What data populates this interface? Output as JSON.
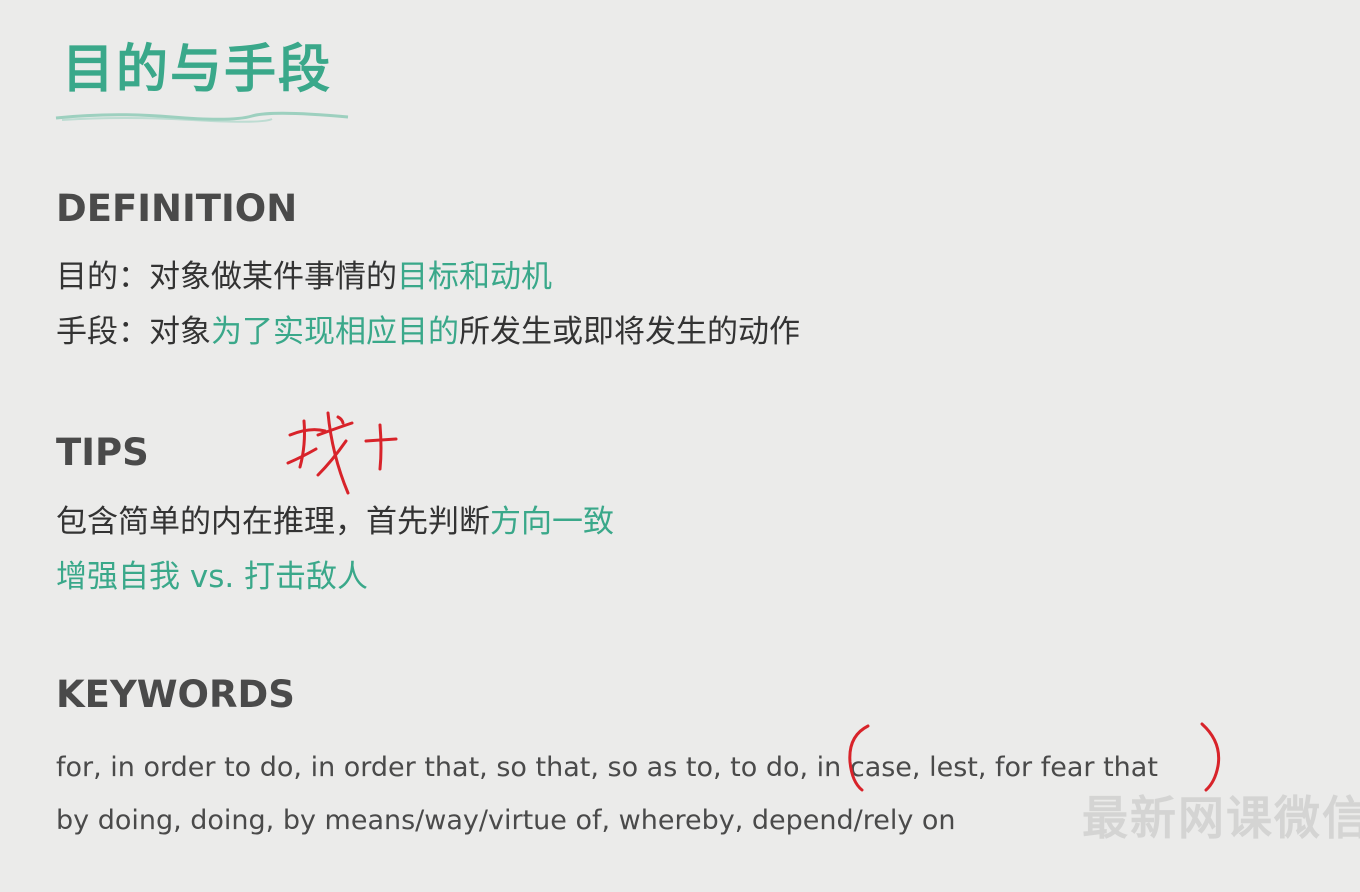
{
  "title": "目的与手段",
  "definition": {
    "heading": "DEFINITION",
    "line1": {
      "prefix": "目的：对象做某件事情的",
      "highlight": "目标和动机"
    },
    "line2": {
      "prefix": "手段：对象",
      "highlight": "为了实现相应目的",
      "suffix": "所发生或即将发生的动作"
    }
  },
  "tips": {
    "heading": "TIPS",
    "annotation": "找 +",
    "line1": {
      "prefix": "包含简单的内在推理，首先判断",
      "highlight": "方向一致"
    },
    "line2": "增强自我 vs. 打击敌人"
  },
  "keywords": {
    "heading": "KEYWORDS",
    "line1_start": "for, in order to do, in order that, so that, so as to, to do, ",
    "line1_bracketed": "in case, lest, for fear that",
    "line2": "by doing, doing, by means/way/virtue of, whereby, depend/rely on"
  },
  "watermark": "最新网课微信",
  "colors": {
    "accent": "#3aa88a",
    "ink": "#d8232a",
    "background": "#ebebea"
  }
}
